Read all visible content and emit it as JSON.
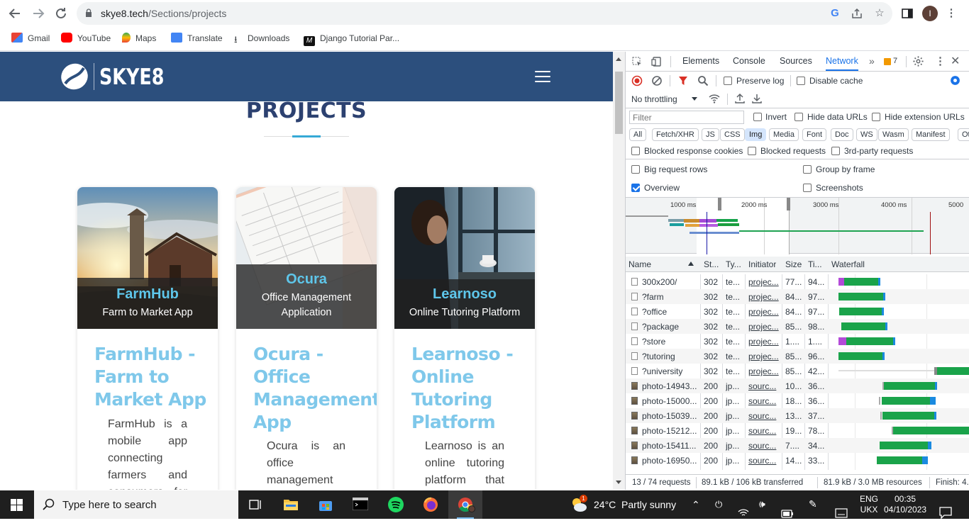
{
  "browser": {
    "url_domain": "skye8.tech",
    "url_path": "/Sections/projects",
    "profile_initial": "I",
    "bookmarks": [
      "Gmail",
      "YouTube",
      "Maps",
      "Translate",
      "Downloads",
      "Django Tutorial Par..."
    ]
  },
  "site": {
    "logo_text": "SKYE8",
    "page_heading": "PROJECTS",
    "cards": [
      {
        "overlay_title": "FarmHub",
        "overlay_sub": "Farm to Market App",
        "title": "FarmHub - Farm to Market App",
        "description": "FarmHub is a mobile app connecting farmers and consumers for"
      },
      {
        "overlay_title": "Ocura",
        "overlay_sub": "Office Management Application",
        "title": "Ocura - Office Management App",
        "description": "Ocura is an office management"
      },
      {
        "overlay_title": "Learnoso",
        "overlay_sub": "Online Tutoring Platform",
        "title": "Learnoso - Online Tutoring Platform",
        "description": "Learnoso is an online tutoring platform that"
      }
    ]
  },
  "devtools": {
    "tabs": [
      "Elements",
      "Console",
      "Sources",
      "Network"
    ],
    "active_tab": "Network",
    "issues_count": "7",
    "toolbar": {
      "preserve_log": "Preserve log",
      "disable_cache": "Disable cache",
      "throttling": "No throttling"
    },
    "filter": {
      "placeholder": "Filter",
      "invert": "Invert",
      "hide_data_urls": "Hide data URLs",
      "hide_extension_urls": "Hide extension URLs"
    },
    "type_chips": [
      "All",
      "Fetch/XHR",
      "JS",
      "CSS",
      "Img",
      "Media",
      "Font",
      "Doc",
      "WS",
      "Wasm",
      "Manifest",
      "Oth"
    ],
    "active_chip": "Img",
    "options": {
      "blocked_cookies": "Blocked response cookies",
      "blocked_requests": "Blocked requests",
      "third_party": "3rd-party requests",
      "big_rows": "Big request rows",
      "group_by_frame": "Group by frame",
      "overview": "Overview",
      "screenshots": "Screenshots"
    },
    "overview_ticks": [
      "1000 ms",
      "2000 ms",
      "3000 ms",
      "4000 ms",
      "5000"
    ],
    "columns": [
      "Name",
      "St...",
      "Ty...",
      "Initiator",
      "Size",
      "Ti...",
      "Waterfall"
    ],
    "rows": [
      {
        "name": "300x200/",
        "status": "302",
        "type": "te...",
        "initiator": "projec...",
        "size": "77...",
        "time": "94...",
        "icon": "doc"
      },
      {
        "name": "?farm",
        "status": "302",
        "type": "te...",
        "initiator": "projec...",
        "size": "84...",
        "time": "97...",
        "icon": "doc"
      },
      {
        "name": "?office",
        "status": "302",
        "type": "te...",
        "initiator": "projec...",
        "size": "84...",
        "time": "97...",
        "icon": "doc"
      },
      {
        "name": "?package",
        "status": "302",
        "type": "te...",
        "initiator": "projec...",
        "size": "85...",
        "time": "98...",
        "icon": "doc"
      },
      {
        "name": "?store",
        "status": "302",
        "type": "te...",
        "initiator": "projec...",
        "size": "1....",
        "time": "1....",
        "icon": "doc"
      },
      {
        "name": "?tutoring",
        "status": "302",
        "type": "te...",
        "initiator": "projec...",
        "size": "85...",
        "time": "96...",
        "icon": "doc"
      },
      {
        "name": "?university",
        "status": "302",
        "type": "te...",
        "initiator": "projec...",
        "size": "85...",
        "time": "42...",
        "icon": "doc"
      },
      {
        "name": "photo-14943...",
        "status": "200",
        "type": "jp...",
        "initiator": "sourc...",
        "size": "10...",
        "time": "36...",
        "icon": "img"
      },
      {
        "name": "photo-15000...",
        "status": "200",
        "type": "jp...",
        "initiator": "sourc...",
        "size": "18...",
        "time": "36...",
        "icon": "img"
      },
      {
        "name": "photo-15039...",
        "status": "200",
        "type": "jp...",
        "initiator": "sourc...",
        "size": "13...",
        "time": "37...",
        "icon": "img"
      },
      {
        "name": "photo-15212...",
        "status": "200",
        "type": "jp...",
        "initiator": "sourc...",
        "size": "19...",
        "time": "78...",
        "icon": "img"
      },
      {
        "name": "photo-15411...",
        "status": "200",
        "type": "jp...",
        "initiator": "sourc...",
        "size": "7....",
        "time": "34...",
        "icon": "img"
      },
      {
        "name": "photo-16950...",
        "status": "200",
        "type": "jp...",
        "initiator": "sourc...",
        "size": "14...",
        "time": "33...",
        "icon": "img"
      }
    ],
    "status_bar": {
      "requests": "13 / 74 requests",
      "transferred": "89.1 kB / 106 kB transferred",
      "resources": "81.9 kB / 3.0 MB resources",
      "finish": "Finish: 4."
    }
  },
  "taskbar": {
    "search_placeholder": "Type here to search",
    "weather": "24°C  Partly sunny",
    "language": "ENG",
    "region": "UKX",
    "time": "00:35",
    "date": "04/10/2023",
    "weather_badge": "1"
  },
  "colors": {
    "site_header": "#2c4f7d",
    "accent_blue": "#5ec6ea",
    "devtools_active": "#1a73e8"
  }
}
